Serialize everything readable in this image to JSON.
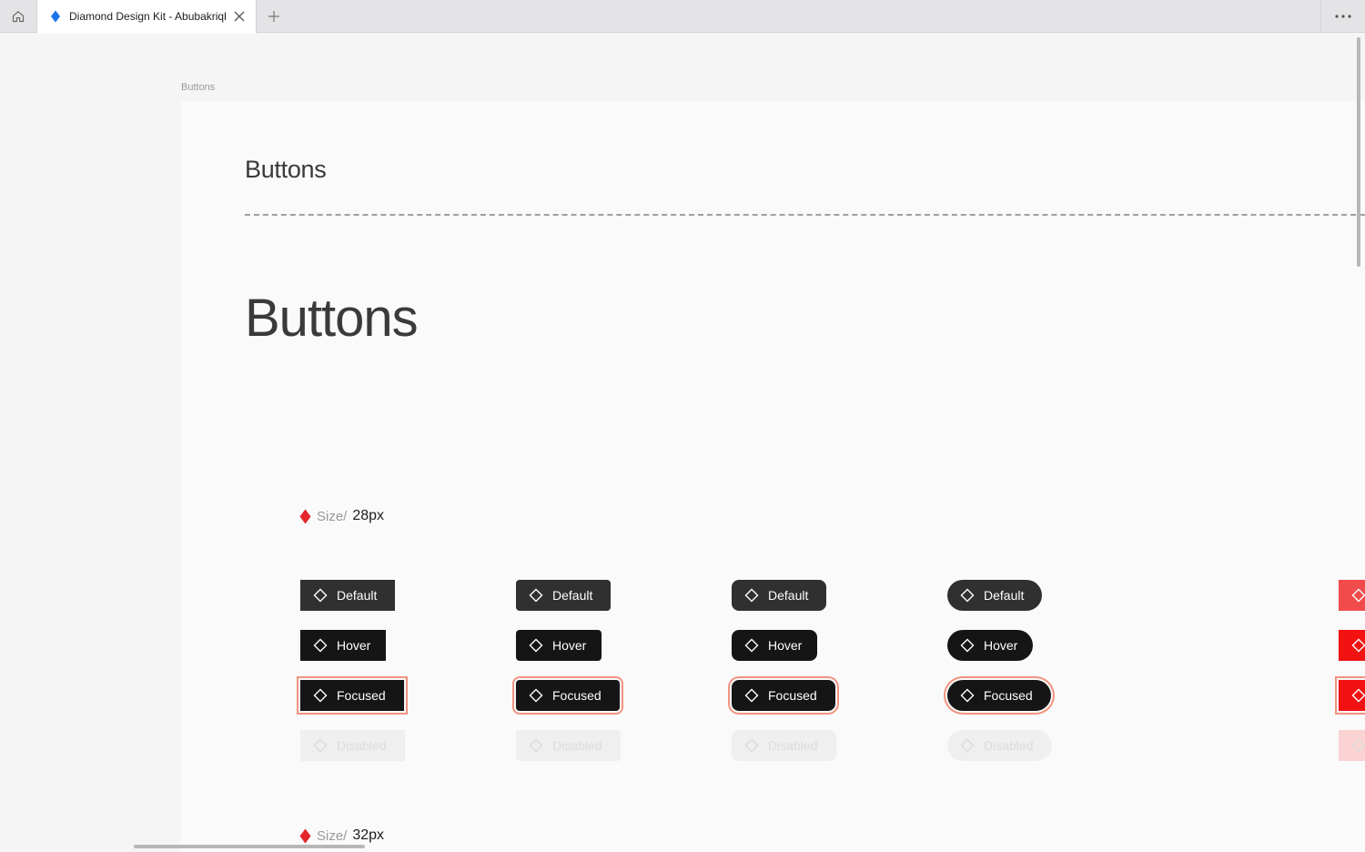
{
  "tab": {
    "title": "Diamond Design Kit - Abubakriqbal"
  },
  "frame": {
    "label": "Buttons"
  },
  "page": {
    "title_small": "Buttons",
    "title_large": "Buttons"
  },
  "sizes": [
    {
      "prefix": "Size/",
      "value": "28px"
    },
    {
      "prefix": "Size/",
      "value": "32px"
    }
  ],
  "buttons": {
    "default": "Default",
    "hover": "Hover",
    "focused": "Focused",
    "disabled": "Disabled"
  },
  "colors": {
    "tab_icon": "#1a73e8",
    "size_diamond": "#e3262b",
    "focus_ring": "#f2937f",
    "danger": "#f21212"
  },
  "icons": {
    "button": "diamond-outline-icon",
    "size": "diamond-filled-icon"
  }
}
